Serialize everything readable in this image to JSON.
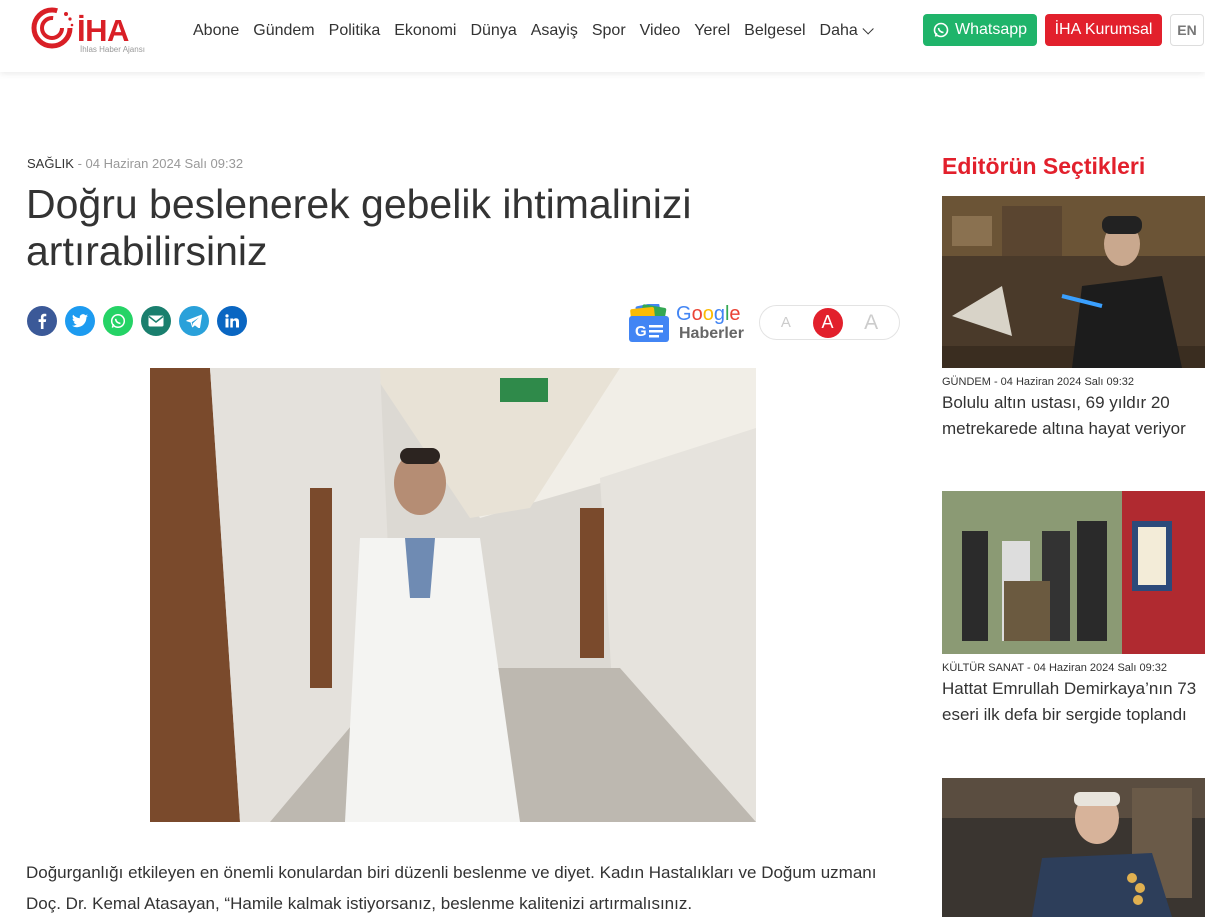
{
  "header": {
    "logo_text": "İHA",
    "logo_sub": "İhlas Haber Ajansı",
    "nav": [
      "Abone",
      "Gündem",
      "Politika",
      "Ekonomi",
      "Dünya",
      "Asayiş",
      "Spor",
      "Video",
      "Yerel",
      "Belgesel"
    ],
    "more_label": "Daha",
    "whatsapp_label": "Whatsapp",
    "corporate_label": "İHA Kurumsal",
    "lang_label": "EN"
  },
  "article": {
    "category": "SAĞLIK",
    "date": " - 04 Haziran 2024 Salı 09:32",
    "title": "Doğru beslenerek gebelik ihtimalinizi artırabilirsiniz",
    "body": "Doğurganlığı etkileyen en önemli konulardan biri düzenli beslenme ve diyet. Kadın Hastalıkları ve Doğum uzmanı Doç. Dr. Kemal Atasayan, “Hamile kalmak istiyorsanız, beslenme kalitenizi artırmalısınız."
  },
  "google_news": {
    "line1": "Google",
    "line2": "Haberler"
  },
  "font_size": {
    "small": "A",
    "medium": "A",
    "large": "A"
  },
  "sidebar": {
    "title": "Editörün Seçtikleri",
    "cards": [
      {
        "category": "GÜNDEM",
        "date": " - 04 Haziran 2024 Salı 09:32",
        "title": "Bolulu altın ustası, 69 yıldır 20 metrekarede altına hayat veriyor"
      },
      {
        "category": "KÜLTÜR SANAT",
        "date": " - 04 Haziran 2024 Salı 09:32",
        "title": "Hattat Emrullah Demirkaya’nın 73 eseri ilk defa bir sergide toplandı"
      },
      {
        "category": "",
        "date": "",
        "title": ""
      }
    ]
  },
  "colors": {
    "brand_red": "#e2202c",
    "whatsapp_green": "#1fb46a"
  }
}
